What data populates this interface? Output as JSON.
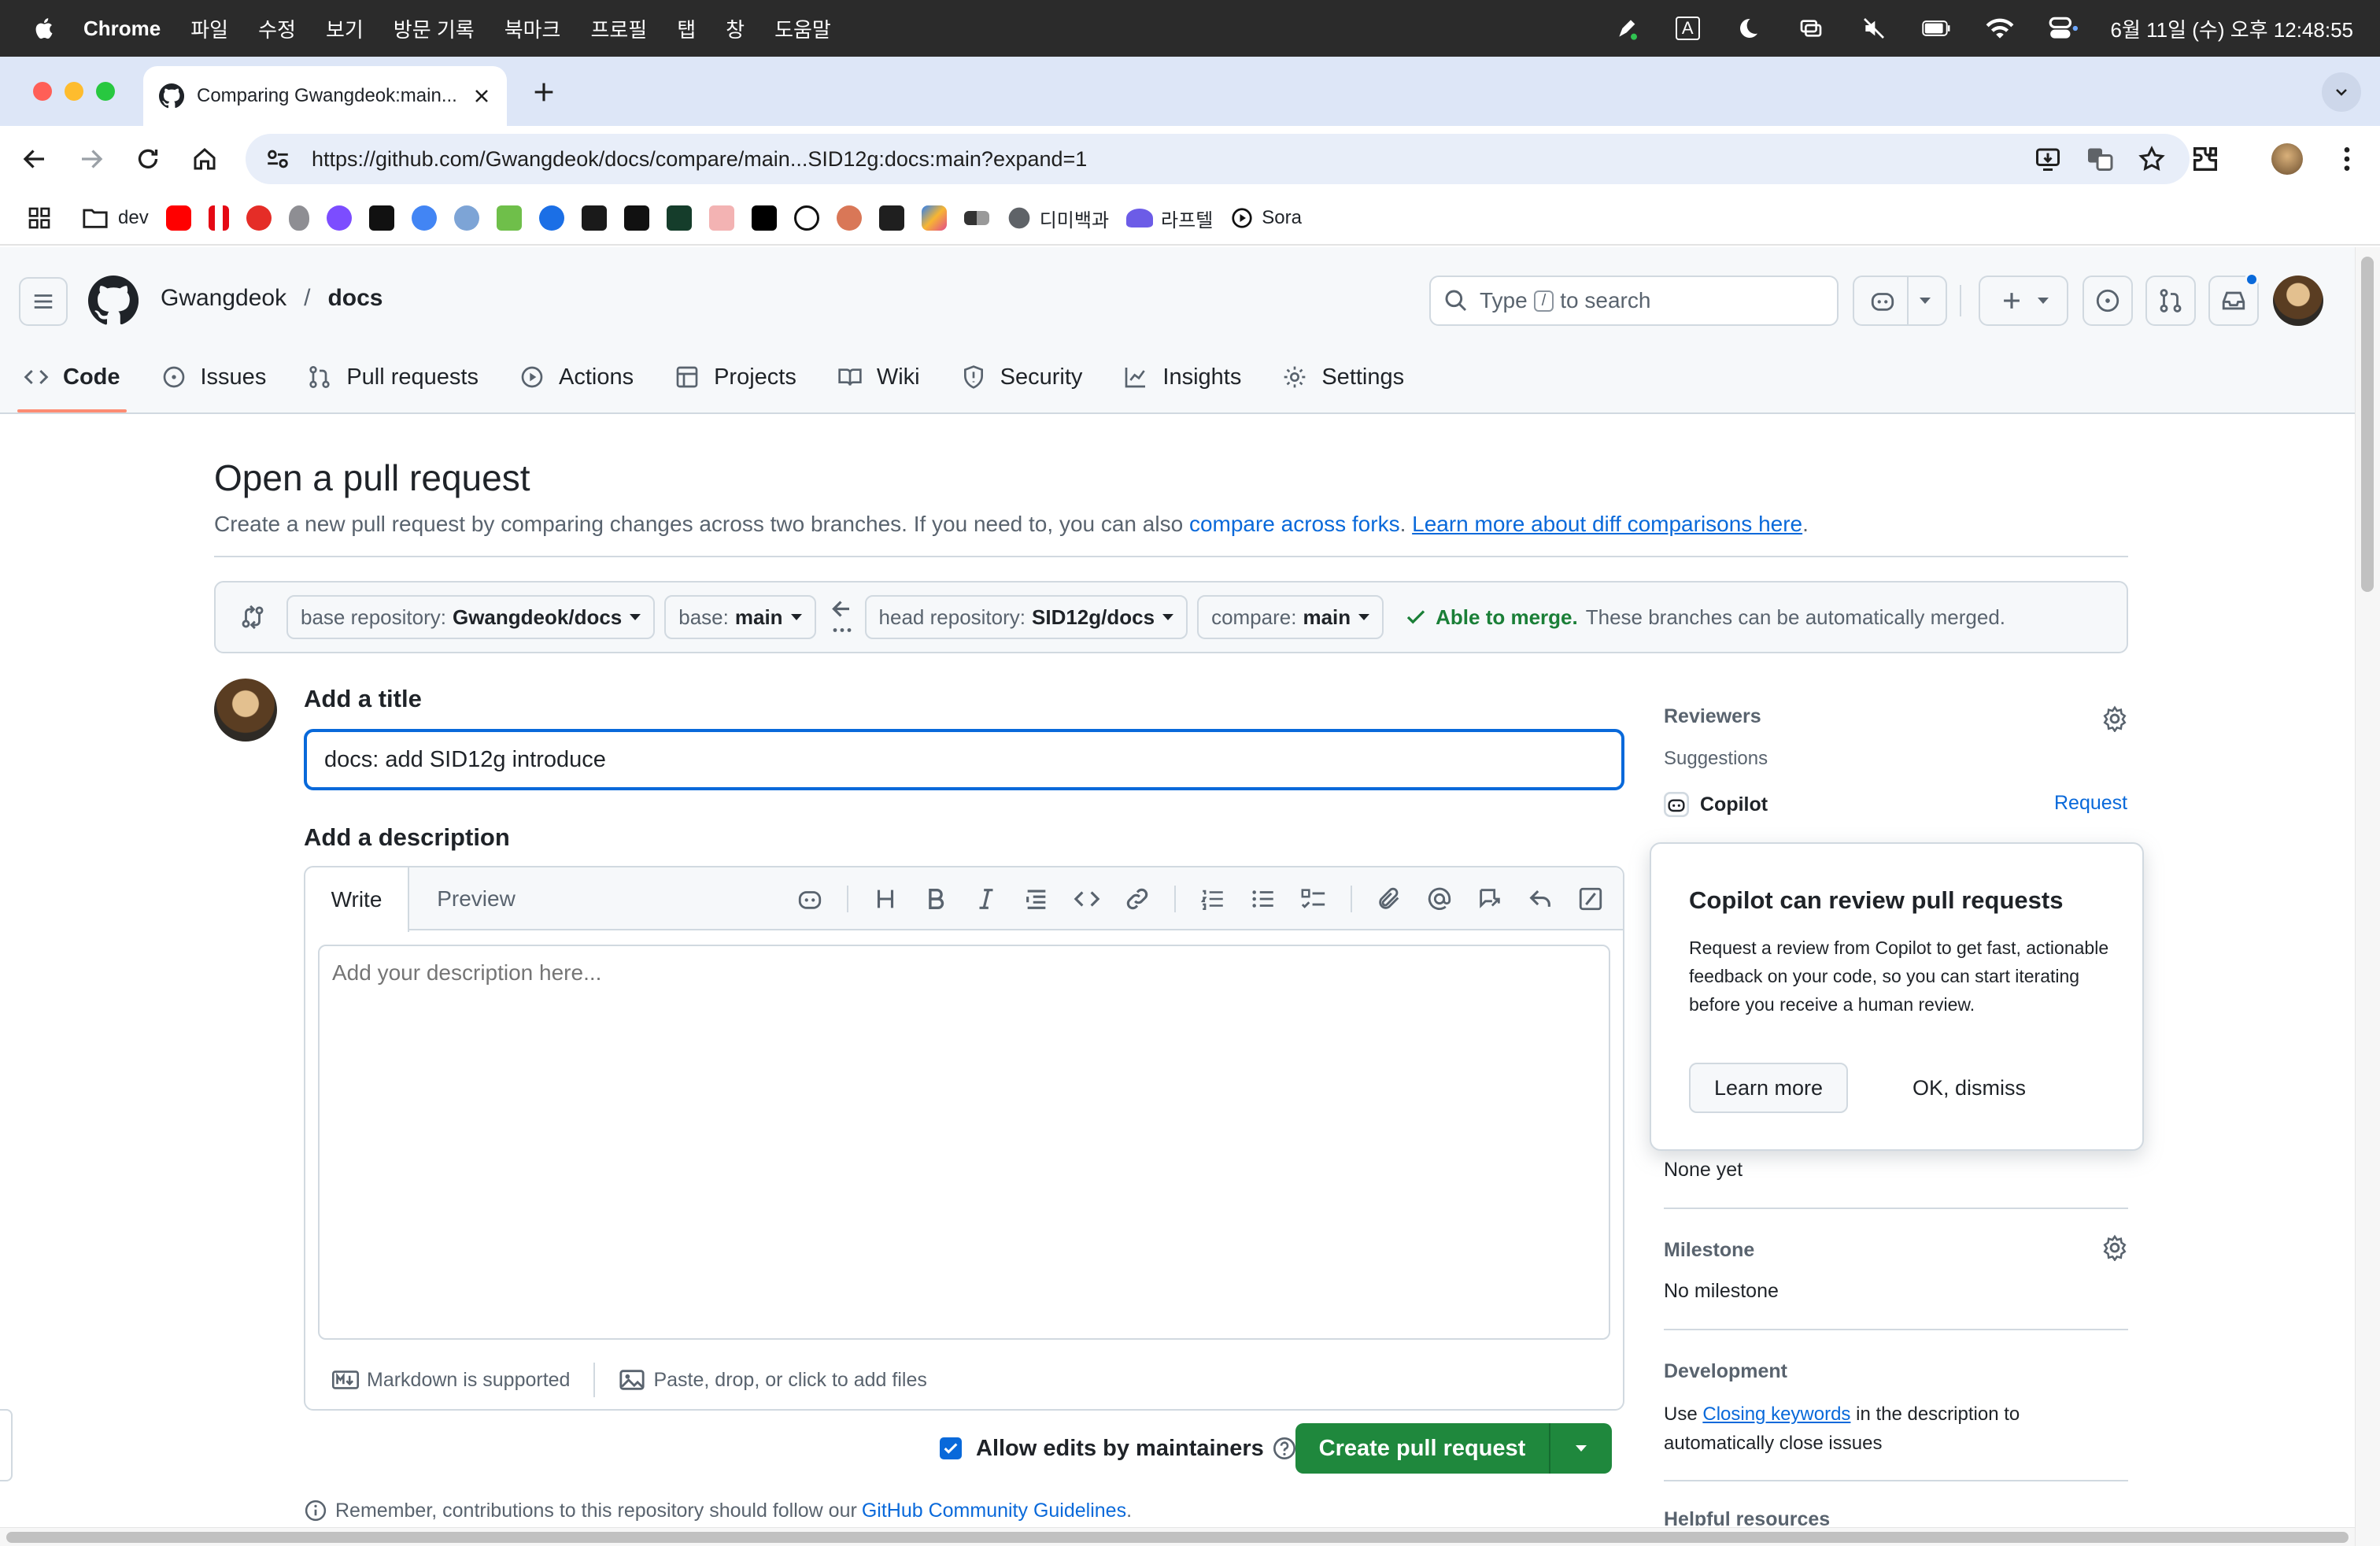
{
  "macos_menubar": {
    "app_name": "Chrome",
    "menus": [
      "파일",
      "수정",
      "보기",
      "방문 기록",
      "북마크",
      "프로필",
      "탭",
      "창",
      "도움말"
    ],
    "clock": "6월 11일 (수) 오후 12:48:55",
    "input_indicator": "A"
  },
  "browser": {
    "tab_title": "Comparing Gwangdeok:main...",
    "url": "https://github.com/Gwangdeok/docs/compare/main...SID12g:docs:main?expand=1",
    "bookmarks": {
      "folder_dev": "dev",
      "dimi": "디미백과",
      "laftel": "라프텔",
      "sora": "Sora"
    }
  },
  "github": {
    "owner": "Gwangdeok",
    "repo": "docs",
    "search_type": "Type",
    "search_key": "/",
    "search_rest": "to search",
    "repo_nav": [
      "Code",
      "Issues",
      "Pull requests",
      "Actions",
      "Projects",
      "Wiki",
      "Security",
      "Insights",
      "Settings"
    ]
  },
  "page": {
    "title": "Open a pull request",
    "subtitle_prefix": "Create a new pull request by comparing changes across two branches. If you need to, you can also",
    "link_forks": "compare across forks",
    "link_learn": "Learn more about diff comparisons here",
    "compare": {
      "base_repo_label": "base repository:",
      "base_repo": "Gwangdeok/docs",
      "base_label": "base:",
      "base": "main",
      "head_repo_label": "head repository:",
      "head_repo": "SID12g/docs",
      "compare_label": "compare:",
      "compare": "main",
      "merge_status": "Able to merge.",
      "merge_message": "These branches can be automatically merged."
    },
    "title_label": "Add a title",
    "title_value": "docs: add SID12g introduce",
    "desc_label": "Add a description",
    "tab_write": "Write",
    "tab_preview": "Preview",
    "desc_placeholder": "Add your description here...",
    "markdown_note": "Markdown is supported",
    "attach_note": "Paste, drop, or click to add files",
    "allow_edits": "Allow edits by maintainers",
    "create_button": "Create pull request",
    "remember_prefix": "Remember, contributions to this repository should follow our",
    "remember_link": "GitHub Community Guidelines",
    "remember_suffix": "."
  },
  "sidebar": {
    "reviewers_heading": "Reviewers",
    "suggestions": "Suggestions",
    "copilot": "Copilot",
    "request": "Request",
    "popover_title": "Copilot can review pull requests",
    "popover_body": "Request a review from Copilot to get fast, actionable feedback on your code, so you can start iterating before you receive a human review.",
    "popover_learn": "Learn more",
    "popover_dismiss": "OK, dismiss",
    "none_yet": "None yet",
    "milestone_heading": "Milestone",
    "no_milestone": "No milestone",
    "development_heading": "Development",
    "dev_prefix": "Use",
    "dev_link": "Closing keywords",
    "dev_suffix": "in the description to automatically close issues",
    "helpful": "Helpful resources"
  },
  "colors": {
    "accent_blue": "#0969da",
    "success_green": "#1f883d",
    "active_tab_underline": "#fd8c73"
  }
}
